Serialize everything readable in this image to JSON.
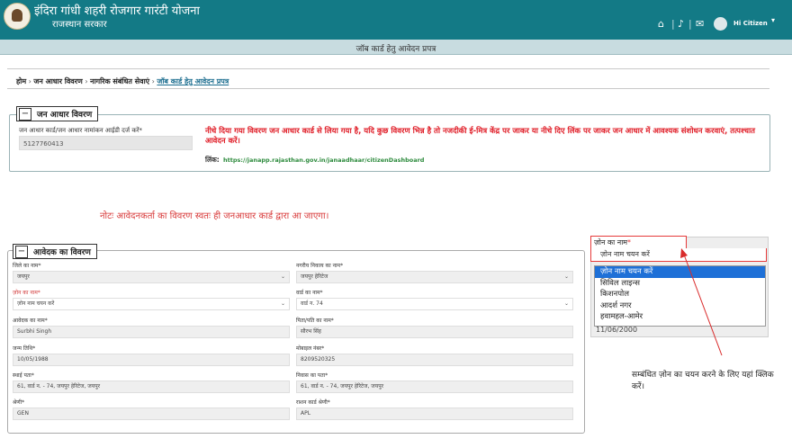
{
  "header": {
    "app_title": "इंदिरा गांधी शहरी रोजगार गारंटी योजना",
    "app_subtitle": "राजस्थान सरकार",
    "icons": [
      "home-icon",
      "bell-icon",
      "mail-icon"
    ],
    "icon_glyphs": {
      "home": "⌂",
      "sep": "|",
      "bell": "♪",
      "mail": "✉"
    },
    "user_label": "Hi Citizen",
    "page_title": "जॉब कार्ड हेतु आवेदन प्रपत्र"
  },
  "breadcrumb": {
    "items": [
      "होम",
      "जन आधार विवरण",
      "नागरिक संबंधित सेवाएं"
    ],
    "current": "जॉब कार्ड हेतु आवेदन प्रपत्र",
    "separator": "›"
  },
  "jan_aadhar": {
    "legend": "जन आधार विवरण",
    "toggle": "−",
    "field_label": "जन आधार कार्ड/जन आधार नामांकन आईडी दर्ज करें*",
    "field_value": "5127760413",
    "warning": "नीचे दिया गया विवरण जन आधार कार्ड से लिया गया है, यदि कुछ विवरण भिन्न है तो नजदीकी ई-मित्र केंद्र पर जाकर या नीचे दिए लिंक पर जाकर जन आधार में आवश्यक संशोधन करवाएं, तत्पश्चात आवेदन करें।",
    "link_label": "लिंक:",
    "link_text": "https://janapp.rajasthan.gov.in/janaadhaar/citizenDashboard"
  },
  "note": "नोटः आवेदनकर्ता का विवरण स्वतः ही जनआधार कार्ड द्वारा आ जाएगा।",
  "applicant": {
    "legend": "आवेदक का विवरण",
    "toggle": "−",
    "fields": {
      "district_label": "जिले का नाम*",
      "district_value": "जयपुर",
      "ulb_label": "नगरीय निकाय का नाम*",
      "ulb_value": "जयपुर हेरिटेज",
      "zone_label": "ज़ोन का नाम*",
      "zone_value": "ज़ोन नाम चयन करें",
      "ward_label": "वार्ड का नाम*",
      "ward_value": "वार्ड न. 74",
      "name_label": "आवेदक का नाम*",
      "name_value": "Surbhi Singh",
      "father_label": "पिता/पति का नाम*",
      "father_value": "सौरभ सिंह",
      "dob_label": "जन्म तिथि*",
      "dob_value": "10/05/1988",
      "mobile_label": "मोबाइल नंबर*",
      "mobile_value": "8209520325",
      "address_label": "स्थाई पता*",
      "address_value": "61, वार्ड न. - 74, जयपुर हेरिटेज, जयपुर",
      "current_address_label": "निवास का पता*",
      "current_address_value": "61, वार्ड न. - 74, जयपुर हेरिटेज, जयपुर",
      "category_label": "श्रेणी*",
      "category_value": "GEN",
      "ration_label": "राशन कार्ड श्रेणी*",
      "ration_value": "APL"
    },
    "caret": "⌄"
  },
  "zone_dropdown": {
    "label": "ज़ोन का नाम",
    "star": "*",
    "selected": "ज़ोन नाम चयन करें",
    "options": [
      "ज़ोन नाम चयन करें",
      "सिविल लाइन्स",
      "किशनपोल",
      "आदर्श नगर",
      "हवामहल-आमेर"
    ],
    "highlighted_index": 0,
    "behind_value": "11/06/2000"
  },
  "annotation": {
    "text": "सम्बंधित ज़ोन का चयन करने के लिए यहां क्लिक करें।",
    "color": "#d92b2b"
  },
  "colors": {
    "header": "#137a86",
    "warning": "#e0202a",
    "link": "#2c8a3c",
    "highlight": "#1e70d7"
  }
}
